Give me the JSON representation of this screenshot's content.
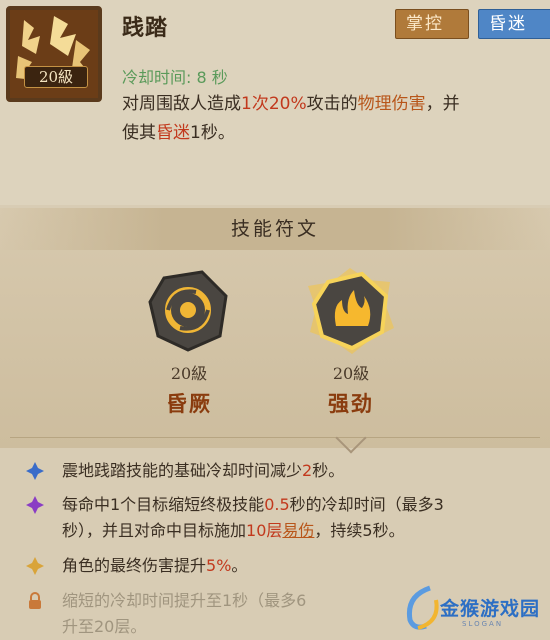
{
  "skill": {
    "icon": "stomp-icon",
    "level_badge": "20級",
    "name": "践踏",
    "tags": [
      {
        "label": "掌控",
        "color": "#b07a3a"
      },
      {
        "label": "昏迷",
        "color": "#4f86c6"
      }
    ],
    "cooldown": "冷却时间: 8 秒",
    "description": {
      "line1_a": "对周围敌人造成",
      "line1_b": "1次",
      "line1_c": "20%",
      "line1_d": "攻击的",
      "line1_e": "物理伤害",
      "line1_f": "，并",
      "line2_a": "使其",
      "line2_b": "昏迷",
      "line2_c": "1秒。"
    }
  },
  "runes": {
    "header": "技能符文",
    "items": [
      {
        "icon": "spiral-rune-icon",
        "level": "20級",
        "name": "昏厥"
      },
      {
        "icon": "flame-rune-icon",
        "level": "20級",
        "name": "强劲",
        "selected": true
      }
    ]
  },
  "effects": [
    {
      "icon": "blue-diamond-icon",
      "parts": [
        "震地践踏技能的基础冷却时间减少",
        "2",
        "秒。"
      ]
    },
    {
      "icon": "purple-diamond-icon",
      "parts": [
        "每命中1个目标缩短终极技能",
        "0.5",
        "秒的冷却时间（最多3",
        "秒），并且对命中目标施加",
        "10层",
        "易伤",
        "，持续5秒。"
      ]
    },
    {
      "icon": "gold-diamond-icon",
      "parts": [
        "角色的最终伤害提升",
        "5%",
        "。"
      ]
    },
    {
      "icon": "lock-icon",
      "parts": [
        "缩短的冷却时间提升至1秒（最多6",
        "升至20层。"
      ]
    }
  ],
  "watermark": {
    "text": "金猴游戏园",
    "sub": "SLOGAN"
  },
  "colors": {
    "red": "#c2391d",
    "orange": "#b8561a",
    "green": "#5a9a5a",
    "rune_name": "#8a3c0e"
  }
}
